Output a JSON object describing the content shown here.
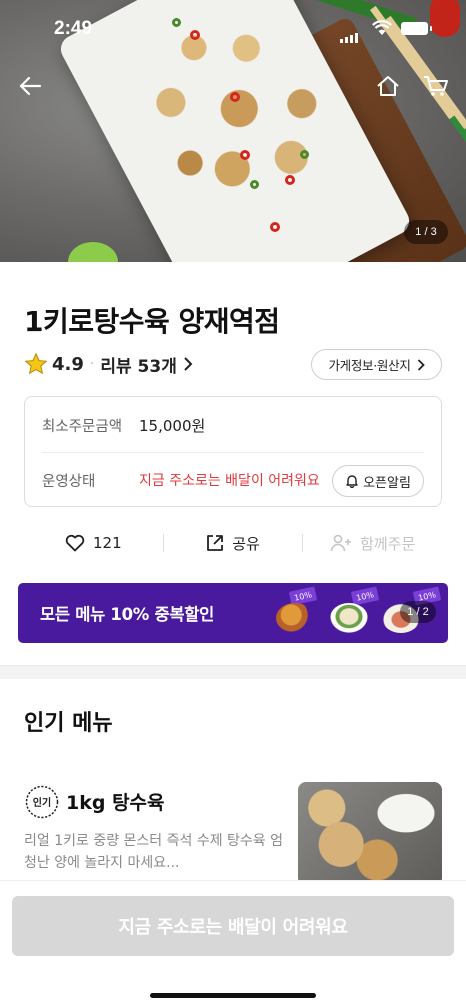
{
  "status_bar": {
    "time": "2:49"
  },
  "hero": {
    "image_counter": "1 / 3"
  },
  "store": {
    "name": "1키로탕수육 양재역점",
    "rating": "4.9",
    "review_label": "리뷰 53개",
    "info_button": "가게정보·원산지"
  },
  "info_box": {
    "min_order_label": "최소주문금액",
    "min_order_value": "15,000원",
    "status_label": "운영상태",
    "status_value": "지금 주소로는 배달이 어려워요",
    "alarm_button": "오픈알림"
  },
  "actions": {
    "like_count": "121",
    "share_label": "공유",
    "group_order_label": "함께주문"
  },
  "banner": {
    "text": "모든 메뉴 10% 중복할인",
    "tag": "10%",
    "counter": "1 / 2"
  },
  "popular": {
    "title": "인기 메뉴",
    "items": [
      {
        "badge": "인기",
        "name": "1kg 탕수육",
        "description": "리얼 1키로 중량 몬스터 즉석 수제 탕수육 엄청난 양에 놀라지 마세요..."
      }
    ]
  },
  "cta": {
    "label": "지금 주소로는 배달이 어려워요"
  },
  "colors": {
    "brand_purple": "#4a1a9e",
    "warning_red": "#e2393a",
    "star_yellow": "#f5c518",
    "disabled_gray": "#d7d7d7"
  }
}
